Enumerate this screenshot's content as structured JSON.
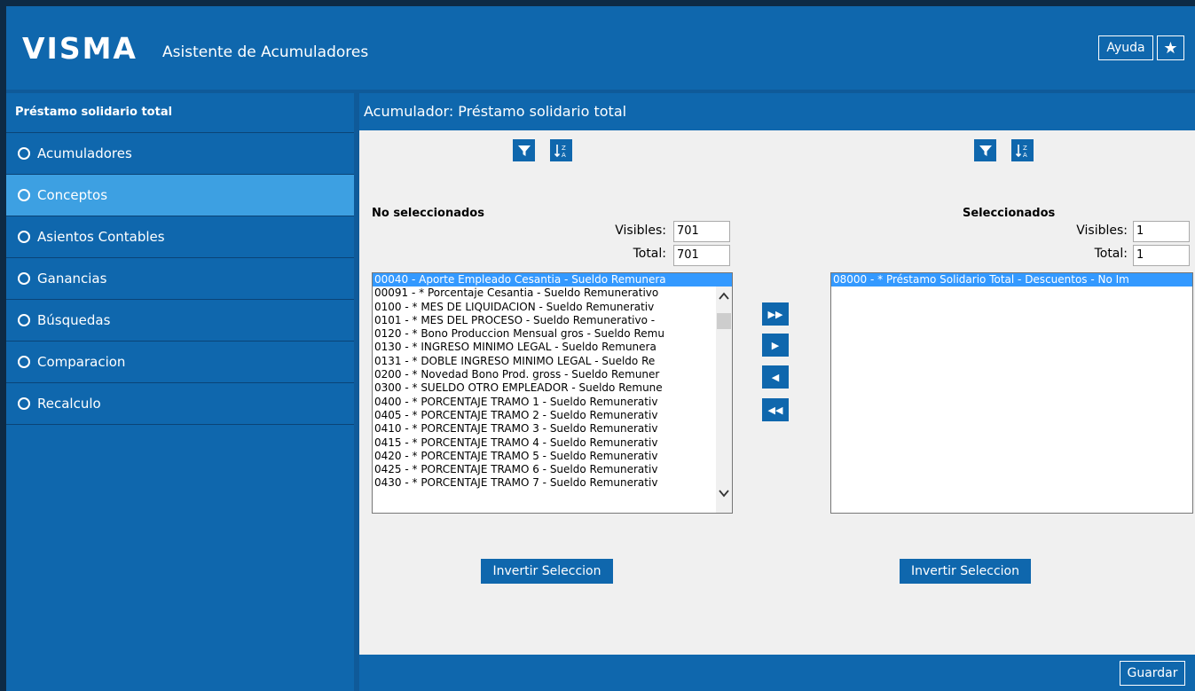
{
  "header": {
    "logo": "VISMA",
    "title": "Asistente de Acumuladores",
    "help_label": "Ayuda",
    "star_icon": "star-icon"
  },
  "sidebar": {
    "title": "Préstamo solidario total",
    "items": [
      {
        "label": "Acumuladores",
        "active": false
      },
      {
        "label": "Conceptos",
        "active": true
      },
      {
        "label": "Asientos Contables",
        "active": false
      },
      {
        "label": "Ganancias",
        "active": false
      },
      {
        "label": "Búsquedas",
        "active": false
      },
      {
        "label": "Comparacion",
        "active": false
      },
      {
        "label": "Recalculo",
        "active": false
      }
    ]
  },
  "main": {
    "title": "Acumulador: Préstamo solidario total",
    "left": {
      "heading": "No seleccionados",
      "visibles_label": "Visibles:",
      "visibles_value": "701",
      "total_label": "Total:",
      "total_value": "701",
      "items": [
        "00040 - Aporte Empleado Cesantia - Sueldo Remunera",
        "00091 - * Porcentaje Cesantia - Sueldo Remunerativo",
        "0100 - * MES DE LIQUIDACION - Sueldo Remunerativ",
        "0101 - * MES DEL PROCESO - Sueldo Remunerativo -",
        "0120 - * Bono Produccion Mensual gros - Sueldo Remu",
        "0130 - * INGRESO MINIMO LEGAL - Sueldo Remunera",
        "0131 - * DOBLE INGRESO MINIMO LEGAL - Sueldo Re",
        "0200 - * Novedad Bono Prod. gross - Sueldo Remuner",
        "0300 - * SUELDO OTRO EMPLEADOR - Sueldo Remune",
        "0400 - * PORCENTAJE TRAMO 1 - Sueldo Remunerativ",
        "0405 - * PORCENTAJE TRAMO 2 - Sueldo Remunerativ",
        "0410 - * PORCENTAJE TRAMO 3 - Sueldo Remunerativ",
        "0415 - * PORCENTAJE TRAMO 4 - Sueldo Remunerativ",
        "0420 - * PORCENTAJE TRAMO 5 - Sueldo Remunerativ",
        "0425 - * PORCENTAJE TRAMO 6 - Sueldo Remunerativ",
        "0430 - * PORCENTAJE TRAMO 7 - Sueldo Remunerativ"
      ],
      "invert_label": "Invertir Seleccion"
    },
    "right": {
      "heading": "Seleccionados",
      "visibles_label": "Visibles:",
      "visibles_value": "1",
      "total_label": "Total:",
      "total_value": "1",
      "items": [
        "08000 - * Préstamo Solidario Total - Descuentos - No Im"
      ],
      "invert_label": "Invertir Seleccion"
    },
    "move_buttons": [
      "▶▶",
      "▶",
      "◀",
      "◀◀"
    ],
    "save_label": "Guardar"
  }
}
